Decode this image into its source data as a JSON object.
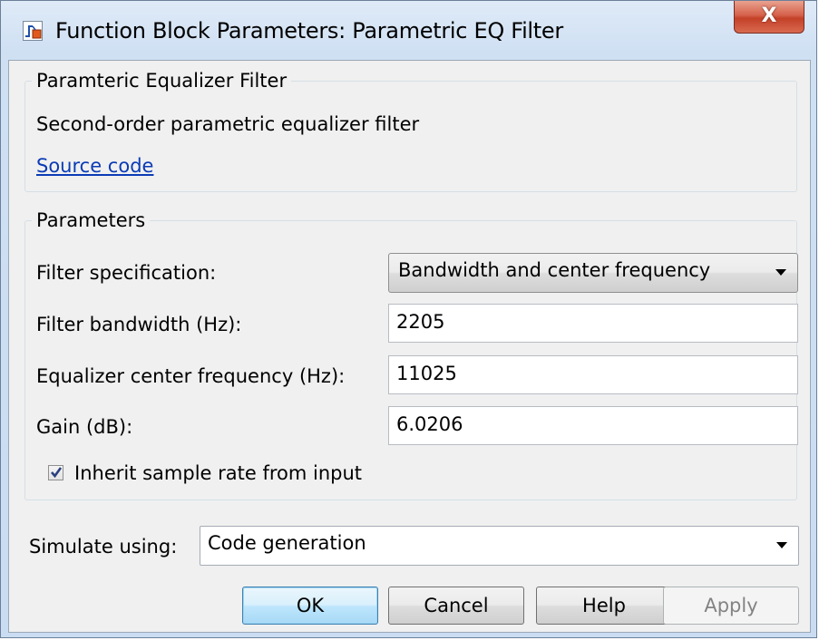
{
  "window": {
    "title": "Function Block Parameters: Parametric EQ Filter",
    "close_glyph": "X"
  },
  "description_group": {
    "legend": "Paramteric Equalizer Filter",
    "description": "Second-order parametric equalizer filter",
    "source_link": "Source code"
  },
  "parameters_group": {
    "legend": "Parameters",
    "filter_spec": {
      "label": "Filter specification:",
      "value": "Bandwidth and center frequency"
    },
    "bandwidth": {
      "label": "Filter bandwidth (Hz):",
      "value": "2205"
    },
    "center_freq": {
      "label": "Equalizer center frequency (Hz):",
      "value": "11025"
    },
    "gain": {
      "label": "Gain (dB):",
      "value": "6.0206"
    },
    "inherit": {
      "label": "Inherit sample rate from input",
      "checked": true
    }
  },
  "simulate": {
    "label": "Simulate using:",
    "value": "Code generation"
  },
  "buttons": {
    "ok": "OK",
    "cancel": "Cancel",
    "help": "Help",
    "apply": "Apply"
  },
  "icons": {
    "app": "simulink-block-icon",
    "close": "close-icon",
    "dropdown": "chevron-down-icon",
    "check": "checkmark-icon"
  },
  "colors": {
    "link": "#0b3bb5",
    "close_button": "#c44128",
    "default_button_border": "#3c7fb1",
    "disabled_text": "#838383"
  }
}
